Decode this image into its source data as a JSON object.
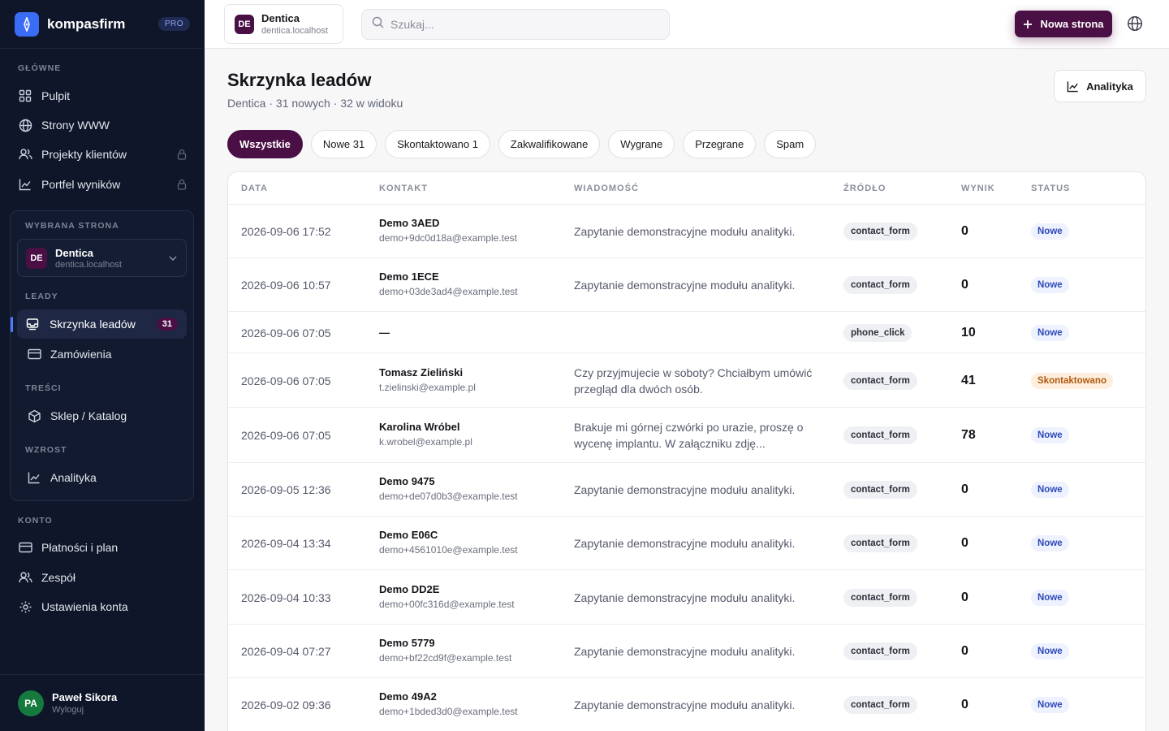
{
  "brand": {
    "name": "kompasfirm",
    "badge": "PRO"
  },
  "sidebar": {
    "section_main": "GŁÓWNE",
    "main_items": [
      {
        "label": "Pulpit",
        "icon": "grid-icon",
        "locked": false
      },
      {
        "label": "Strony WWW",
        "icon": "globe-icon",
        "locked": false
      },
      {
        "label": "Projekty klientów",
        "icon": "users-icon",
        "locked": true
      },
      {
        "label": "Portfel wyników",
        "icon": "chart-icon",
        "locked": true
      }
    ],
    "selected_site_label": "WYBRANA STRONA",
    "selected_site": {
      "initials": "DE",
      "name": "Dentica",
      "domain": "dentica.localhost"
    },
    "section_leads": "LEADY",
    "leads_items": [
      {
        "label": "Skrzynka leadów",
        "icon": "inbox-icon",
        "count": "31",
        "active": true
      },
      {
        "label": "Zamówienia",
        "icon": "card-icon"
      }
    ],
    "section_content": "TREŚCI",
    "content_items": [
      {
        "label": "Sklep / Katalog",
        "icon": "box-icon"
      }
    ],
    "section_growth": "WZROST",
    "growth_items": [
      {
        "label": "Analityka",
        "icon": "chart-icon"
      }
    ],
    "section_account": "KONTO",
    "account_items": [
      {
        "label": "Płatności i plan",
        "icon": "card-icon"
      },
      {
        "label": "Zespół",
        "icon": "users-icon"
      },
      {
        "label": "Ustawienia konta",
        "icon": "gear-icon"
      }
    ],
    "user": {
      "initials": "PA",
      "name": "Paweł Sikora",
      "action": "Wyloguj"
    }
  },
  "topbar": {
    "site": {
      "initials": "DE",
      "name": "Dentica",
      "domain": "dentica.localhost"
    },
    "search_placeholder": "Szukaj...",
    "new_page_label": "Nowa strona"
  },
  "page": {
    "title": "Skrzynka leadów",
    "subtitle": "Dentica · 31 nowych · 32 w widoku",
    "analytics_label": "Analityka"
  },
  "filters": [
    {
      "label": "Wszystkie",
      "active": true
    },
    {
      "label": "Nowe 31",
      "active": false
    },
    {
      "label": "Skontaktowano 1",
      "active": false
    },
    {
      "label": "Zakwalifikowane",
      "active": false
    },
    {
      "label": "Wygrane",
      "active": false
    },
    {
      "label": "Przegrane",
      "active": false
    },
    {
      "label": "Spam",
      "active": false
    }
  ],
  "table": {
    "columns": [
      "DATA",
      "KONTAKT",
      "WIADOMOŚĆ",
      "ŹRÓDŁO",
      "WYNIK",
      "STATUS"
    ],
    "rows": [
      {
        "date": "2026-09-06 17:52",
        "name": "Demo 3AED",
        "email": "demo+9dc0d18a@example.test",
        "message": "Zapytanie demonstracyjne modułu analityki.",
        "source": "contact_form",
        "score": "0",
        "status": "Nowe",
        "status_type": "new"
      },
      {
        "date": "2026-09-06 10:57",
        "name": "Demo 1ECE",
        "email": "demo+03de3ad4@example.test",
        "message": "Zapytanie demonstracyjne modułu analityki.",
        "source": "contact_form",
        "score": "0",
        "status": "Nowe",
        "status_type": "new"
      },
      {
        "date": "2026-09-06 07:05",
        "name": "—",
        "email": "",
        "message": "",
        "source": "phone_click",
        "score": "10",
        "status": "Nowe",
        "status_type": "new"
      },
      {
        "date": "2026-09-06 07:05",
        "name": "Tomasz Zieliński",
        "email": "t.zielinski@example.pl",
        "message": "Czy przyjmujecie w soboty? Chciałbym umówić przegląd dla dwóch osób.",
        "source": "contact_form",
        "score": "41",
        "status": "Skontaktowano",
        "status_type": "contacted"
      },
      {
        "date": "2026-09-06 07:05",
        "name": "Karolina Wróbel",
        "email": "k.wrobel@example.pl",
        "message": "Brakuje mi górnej czwórki po urazie, proszę o wycenę implantu. W załączniku zdję...",
        "source": "contact_form",
        "score": "78",
        "status": "Nowe",
        "status_type": "new"
      },
      {
        "date": "2026-09-05 12:36",
        "name": "Demo 9475",
        "email": "demo+de07d0b3@example.test",
        "message": "Zapytanie demonstracyjne modułu analityki.",
        "source": "contact_form",
        "score": "0",
        "status": "Nowe",
        "status_type": "new"
      },
      {
        "date": "2026-09-04 13:34",
        "name": "Demo E06C",
        "email": "demo+4561010e@example.test",
        "message": "Zapytanie demonstracyjne modułu analityki.",
        "source": "contact_form",
        "score": "0",
        "status": "Nowe",
        "status_type": "new"
      },
      {
        "date": "2026-09-04 10:33",
        "name": "Demo DD2E",
        "email": "demo+00fc316d@example.test",
        "message": "Zapytanie demonstracyjne modułu analityki.",
        "source": "contact_form",
        "score": "0",
        "status": "Nowe",
        "status_type": "new"
      },
      {
        "date": "2026-09-04 07:27",
        "name": "Demo 5779",
        "email": "demo+bf22cd9f@example.test",
        "message": "Zapytanie demonstracyjne modułu analityki.",
        "source": "contact_form",
        "score": "0",
        "status": "Nowe",
        "status_type": "new"
      },
      {
        "date": "2026-09-02 09:36",
        "name": "Demo 49A2",
        "email": "demo+1bded3d0@example.test",
        "message": "Zapytanie demonstracyjne modułu analityki.",
        "source": "contact_form",
        "score": "0",
        "status": "Nowe",
        "status_type": "new"
      }
    ]
  },
  "colors": {
    "sidebar_bg": "#0f1629",
    "accent": "#4a0f44",
    "brand_blue": "#3b6cf6",
    "status_new": "#2d49b8",
    "status_contacted": "#b2590f"
  }
}
